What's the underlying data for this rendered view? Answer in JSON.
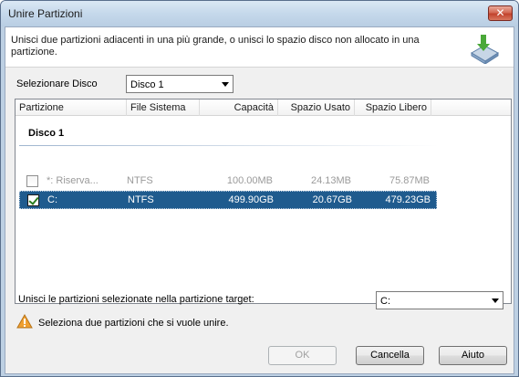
{
  "window": {
    "title": "Unire Partizioni",
    "close_label": "✕"
  },
  "header": {
    "description": "Unisci due partizioni adiacenti in una più grande, o unisci lo spazio disco non allocato in una partizione.",
    "icon": "merge-partition-icon"
  },
  "disk_selector": {
    "label": "Selezionare Disco",
    "value": "Disco 1"
  },
  "table": {
    "columns": [
      "Partizione",
      "File Sistema",
      "Capacità",
      "Spazio Usato",
      "Spazio Libero"
    ],
    "group": "Disco 1",
    "rows": [
      {
        "checked": false,
        "partition": "*: Riserva...",
        "fs": "NTFS",
        "capacity": "100.00MB",
        "used": "24.13MB",
        "free": "75.87MB"
      },
      {
        "checked": true,
        "partition": "C:",
        "fs": "NTFS",
        "capacity": "499.90GB",
        "used": "20.67GB",
        "free": "479.23GB"
      }
    ]
  },
  "target": {
    "label": "Unisci le partizioni selezionate nella partizione target:",
    "value": "C:"
  },
  "warning": {
    "text": "Seleziona due partizioni che si vuole unire.",
    "icon": "warning-icon"
  },
  "buttons": {
    "ok": "OK",
    "cancel": "Cancella",
    "help": "Aiuto"
  },
  "colors": {
    "selection": "#1f5b8e",
    "titlebar": "#c5d8eb",
    "warning": "#f0a030"
  }
}
